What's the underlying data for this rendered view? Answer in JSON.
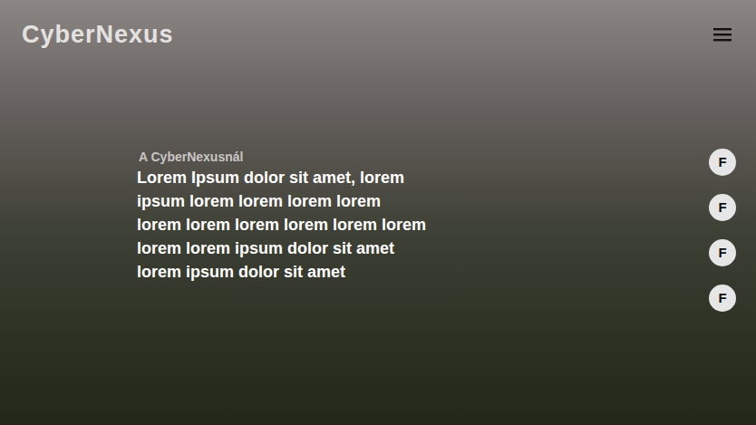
{
  "brand": {
    "name": "CyberNexus"
  },
  "hero": {
    "eyebrow": "A CyberNexusnál",
    "lines": [
      "Lorem Ipsum dolor sit amet, lorem",
      "ipsum lorem lorem lorem lorem",
      "lorem lorem lorem lorem lorem lorem",
      "lorem lorem ipsum dolor sit amet",
      "lorem ipsum dolor sit amet"
    ]
  },
  "social_buttons": [
    {
      "label": "F"
    },
    {
      "label": "F"
    },
    {
      "label": "F"
    },
    {
      "label": "F"
    }
  ]
}
